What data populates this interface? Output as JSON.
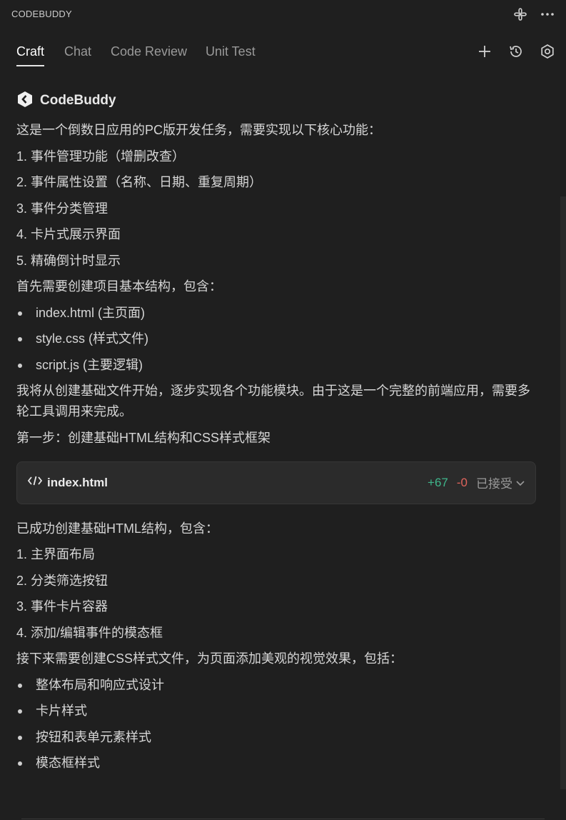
{
  "app": {
    "title": "CODEBUDDY"
  },
  "tabs": [
    "Craft",
    "Chat",
    "Code Review",
    "Unit Test"
  ],
  "brand": {
    "name": "CodeBuddy"
  },
  "intro": {
    "lead": "这是一个倒数日应用的PC版开发任务，需要实现以下核心功能：",
    "items": [
      "1. 事件管理功能（增删改查）",
      "2. 事件属性设置（名称、日期、重复周期）",
      "3. 事件分类管理",
      "4. 卡片式展示界面",
      "5. 精确倒计时显示"
    ],
    "structure_lead": "首先需要创建项目基本结构，包含：",
    "files": [
      "index.html (主页面)",
      "style.css (样式文件)",
      "script.js (主要逻辑)"
    ],
    "plan": "我将从创建基础文件开始，逐步实现各个功能模块。由于这是一个完整的前端应用，需要多轮工具调用来完成。",
    "step": "第一步：创建基础HTML结构和CSS样式框架"
  },
  "file_card": {
    "name": "index.html",
    "added": "+67",
    "removed": "-0",
    "status": "已接受"
  },
  "result": {
    "lead": "已成功创建基础HTML结构，包含：",
    "items": [
      "1. 主界面布局",
      "2. 分类筛选按钮",
      "3. 事件卡片容器",
      "4. 添加/编辑事件的模态框"
    ],
    "next": "接下来需要创建CSS样式文件，为页面添加美观的视觉效果，包括：",
    "bullets": [
      "整体布局和响应式设计",
      "卡片样式",
      "按钮和表单元素样式",
      "模态框样式"
    ]
  },
  "icons": {
    "title_actions": [
      "agent-icon",
      "more-icon"
    ],
    "tab_actions": [
      "plus-icon",
      "history-icon",
      "settings-icon"
    ],
    "brand": "codebuddy-logo-icon",
    "file": "code-icon",
    "status": "chevron-down-icon"
  },
  "colors": {
    "background": "#1f1f1f",
    "added": "#3fb68b",
    "removed": "#e0645c"
  }
}
